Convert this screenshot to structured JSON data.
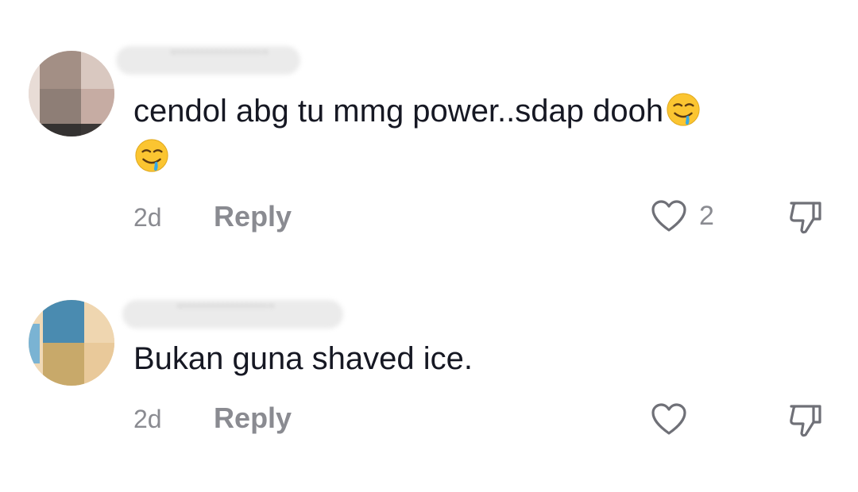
{
  "comments": [
    {
      "text": "cendol abg tu mmg power..sdap dooh",
      "emojis": [
        "drooling-face",
        "drooling-face"
      ],
      "time": "2d",
      "reply_label": "Reply",
      "like_count": "2",
      "avatar_colors": [
        "#a38f85",
        "#8e7e76",
        "#c6aca3",
        "#dacbc5"
      ]
    },
    {
      "text": "Bukan guna shaved ice.",
      "emojis": [],
      "time": "2d",
      "reply_label": "Reply",
      "like_count": "",
      "avatar_colors": [
        "#4a8bb0",
        "#c8a96a",
        "#efd6b0",
        "#e9c99a"
      ]
    }
  ],
  "colors": {
    "text": "#161823",
    "meta": "#8a8b91",
    "background": "#ffffff"
  },
  "icons": [
    "heart-outline-icon",
    "thumbs-down-icon"
  ]
}
